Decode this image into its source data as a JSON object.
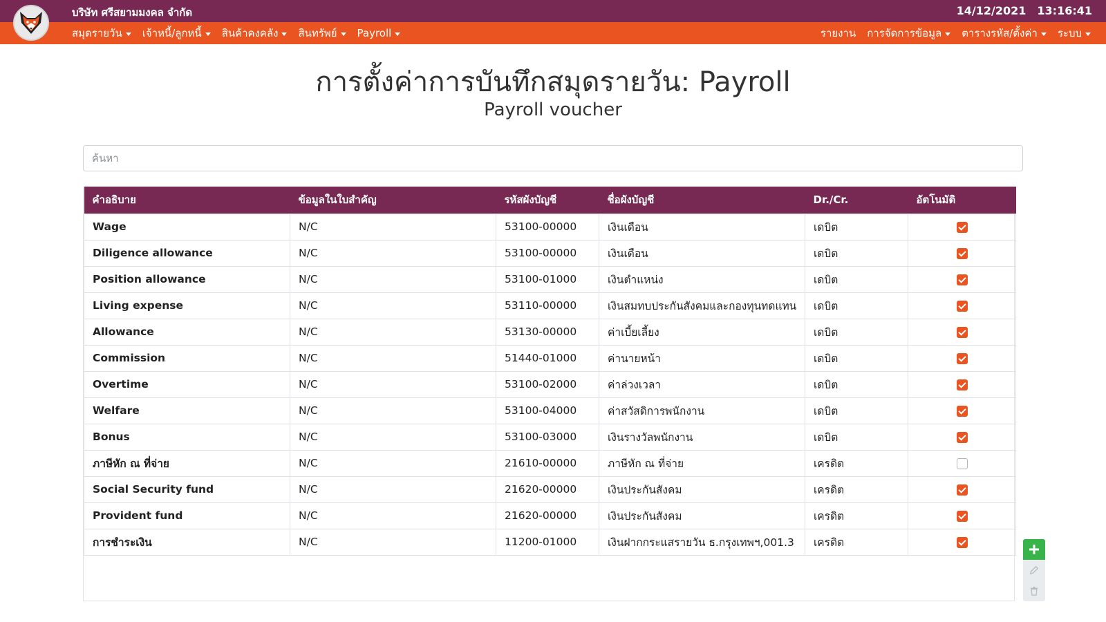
{
  "app": {
    "company": "บริษัท ศรีสยามมงคล จำกัด",
    "date": "14/12/2021",
    "time": "13:16:41"
  },
  "colors": {
    "topbar": "#772953",
    "navbar": "#E95420",
    "checkbox": "#E95420",
    "add_button": "#38B44A"
  },
  "nav": {
    "left": [
      {
        "label": "สมุดรายวัน",
        "dropdown": true
      },
      {
        "label": "เจ้าหนี้/ลูกหนี้",
        "dropdown": true
      },
      {
        "label": "สินค้าคงคลัง",
        "dropdown": true
      },
      {
        "label": "สินทรัพย์",
        "dropdown": true
      },
      {
        "label": "Payroll",
        "dropdown": true
      }
    ],
    "right": [
      {
        "label": "รายงาน",
        "dropdown": false
      },
      {
        "label": "การจัดการข้อมูล",
        "dropdown": true
      },
      {
        "label": "ตารางรหัส/ตั้งค่า",
        "dropdown": true
      },
      {
        "label": "ระบบ",
        "dropdown": true
      }
    ]
  },
  "page": {
    "title": "การตั้งค่าการบันทึกสมุดรายวัน: Payroll",
    "subtitle": "Payroll voucher"
  },
  "search": {
    "placeholder": "ค้นหา",
    "value": ""
  },
  "table": {
    "columns": [
      "คำอธิบาย",
      "ข้อมูลในใบสำคัญ",
      "รหัสผังบัญชี",
      "ชื่อผังบัญชี",
      "Dr./Cr.",
      "อัตโนมัติ"
    ],
    "rows": [
      {
        "desc": "Wage",
        "info": "N/C",
        "code": "53100-00000",
        "name": "เงินเดือน",
        "drcr": "เดบิต",
        "auto": true
      },
      {
        "desc": "Diligence allowance",
        "info": "N/C",
        "code": "53100-00000",
        "name": "เงินเดือน",
        "drcr": "เดบิต",
        "auto": true
      },
      {
        "desc": "Position allowance",
        "info": "N/C",
        "code": "53100-01000",
        "name": "เงินตำแหน่ง",
        "drcr": "เดบิต",
        "auto": true
      },
      {
        "desc": "Living expense",
        "info": "N/C",
        "code": "53110-00000",
        "name": "เงินสมทบประกันสังคมและกองทุนทดแทน",
        "drcr": "เดบิต",
        "auto": true
      },
      {
        "desc": "Allowance",
        "info": "N/C",
        "code": "53130-00000",
        "name": "ค่าเบี้ยเลี้ยง",
        "drcr": "เดบิต",
        "auto": true
      },
      {
        "desc": "Commission",
        "info": "N/C",
        "code": "51440-01000",
        "name": "ค่านายหน้า",
        "drcr": "เดบิต",
        "auto": true
      },
      {
        "desc": "Overtime",
        "info": "N/C",
        "code": "53100-02000",
        "name": "ค่าล่วงเวลา",
        "drcr": "เดบิต",
        "auto": true
      },
      {
        "desc": "Welfare",
        "info": "N/C",
        "code": "53100-04000",
        "name": "ค่าสวัสดิการพนักงาน",
        "drcr": "เดบิต",
        "auto": true
      },
      {
        "desc": "Bonus",
        "info": "N/C",
        "code": "53100-03000",
        "name": "เงินรางวัลพนักงาน",
        "drcr": "เดบิต",
        "auto": true
      },
      {
        "desc": "ภาษีหัก ณ ที่จ่าย",
        "info": "N/C",
        "code": "21610-00000",
        "name": "ภาษีหัก ณ ที่จ่าย",
        "drcr": "เครดิต",
        "auto": false
      },
      {
        "desc": "Social Security fund",
        "info": "N/C",
        "code": "21620-00000",
        "name": "เงินประกันสังคม",
        "drcr": "เครดิต",
        "auto": true
      },
      {
        "desc": "Provident fund",
        "info": "N/C",
        "code": "21620-00000",
        "name": "เงินประกันสังคม",
        "drcr": "เครดิต",
        "auto": true
      },
      {
        "desc": "การชำระเงิน",
        "info": "N/C",
        "code": "11200-01000",
        "name": "เงินฝากกระแสรายวัน ธ.กรุงเทพฯ,001.3",
        "drcr": "เครดิต",
        "auto": true
      }
    ]
  },
  "actions": {
    "icons": [
      "plus-icon",
      "pencil-icon",
      "trash-icon"
    ]
  }
}
